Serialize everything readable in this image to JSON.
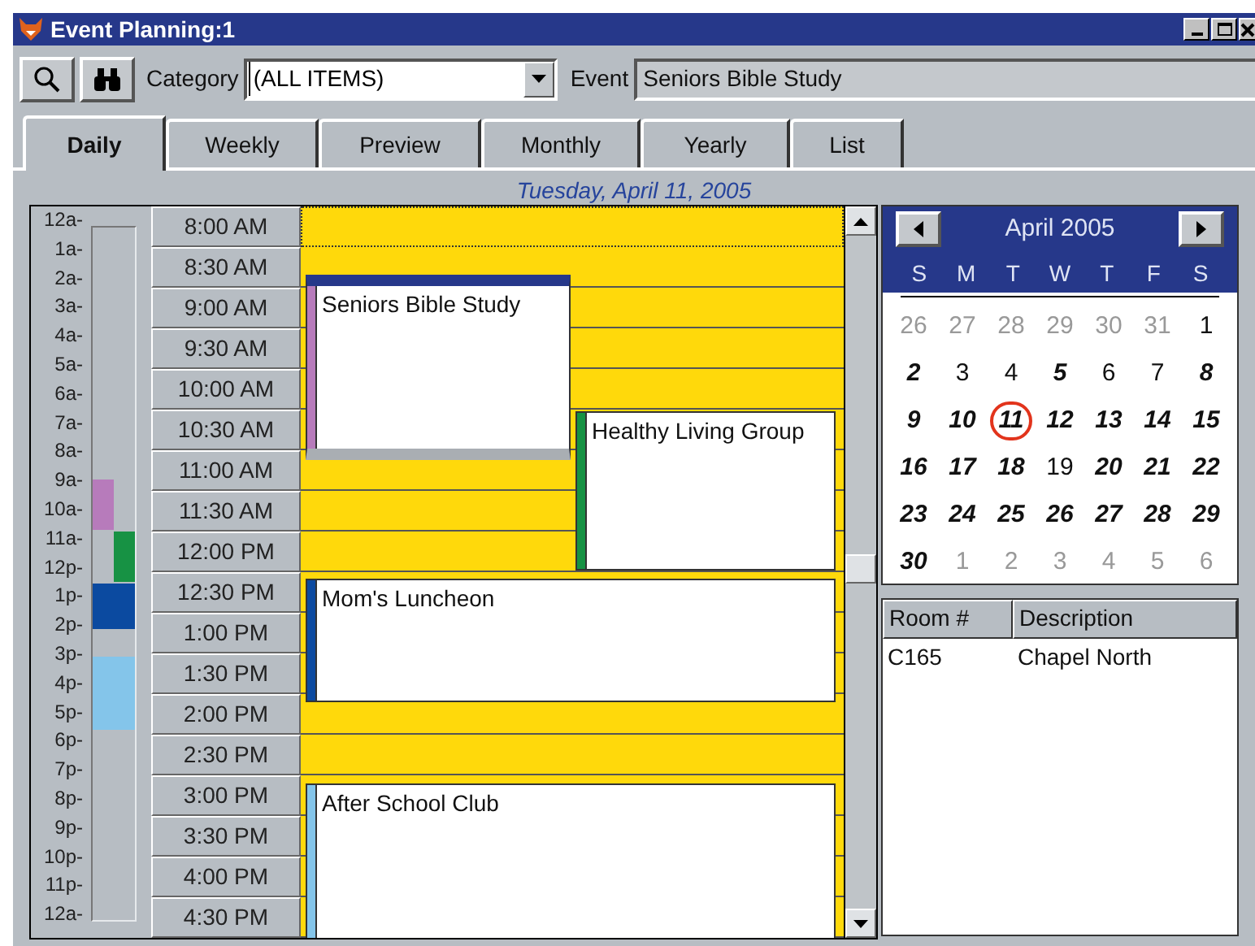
{
  "window": {
    "title": "Event Planning:1"
  },
  "toolbar": {
    "category_label": "Category",
    "category": "(ALL ITEMS)",
    "event_label": "Event",
    "event": "Seniors Bible Study"
  },
  "tabs": [
    {
      "label": "Daily",
      "selected": true
    },
    {
      "label": "Weekly",
      "selected": false
    },
    {
      "label": "Preview",
      "selected": false
    },
    {
      "label": "Monthly",
      "selected": false
    },
    {
      "label": "Yearly",
      "selected": false
    },
    {
      "label": "List",
      "selected": false
    }
  ],
  "date_heading": "Tuesday, April 11, 2005",
  "hour_labels": [
    "12a-",
    "1a-",
    "2a-",
    "3a-",
    "4a-",
    "5a-",
    "6a-",
    "7a-",
    "8a-",
    "9a-",
    "10a-",
    "11a-",
    "12p-",
    "1p-",
    "2p-",
    "3p-",
    "4p-",
    "5p-",
    "6p-",
    "7p-",
    "8p-",
    "9p-",
    "10p-",
    "11p-",
    "12a-"
  ],
  "time_slots": [
    {
      "label": "8:00 AM",
      "selected": true
    },
    {
      "label": "8:30 AM",
      "selected": false
    },
    {
      "label": "9:00 AM",
      "selected": false
    },
    {
      "label": "9:30 AM",
      "selected": false
    },
    {
      "label": "10:00 AM",
      "selected": false
    },
    {
      "label": "10:30 AM",
      "selected": false
    },
    {
      "label": "11:00 AM",
      "selected": false
    },
    {
      "label": "11:30 AM",
      "selected": false
    },
    {
      "label": "12:00 PM",
      "selected": false
    },
    {
      "label": "12:30 PM",
      "selected": false
    },
    {
      "label": "1:00 PM",
      "selected": false
    },
    {
      "label": "1:30 PM",
      "selected": false
    },
    {
      "label": "2:00 PM",
      "selected": false
    },
    {
      "label": "2:30 PM",
      "selected": false
    },
    {
      "label": "3:00 PM",
      "selected": false
    },
    {
      "label": "3:30 PM",
      "selected": false
    },
    {
      "label": "4:00 PM",
      "selected": false
    },
    {
      "label": "4:30 PM",
      "selected": false
    }
  ],
  "events": [
    {
      "title": "Seniors Bible Study",
      "color": "#b77bbb",
      "selected": true
    },
    {
      "title": "Healthy Living Group",
      "color": "#179244",
      "selected": false
    },
    {
      "title": "Mom's Luncheon",
      "color": "#0b4aa0",
      "selected": false
    },
    {
      "title": "After School Club",
      "color": "#84c5ea",
      "selected": false
    }
  ],
  "calendar": {
    "month": "April 2005",
    "weekdays": [
      "S",
      "M",
      "T",
      "W",
      "T",
      "F",
      "S"
    ],
    "days": [
      {
        "label": "26",
        "kind": "other"
      },
      {
        "label": "27",
        "kind": "other"
      },
      {
        "label": "28",
        "kind": "other"
      },
      {
        "label": "29",
        "kind": "other"
      },
      {
        "label": "30",
        "kind": "other"
      },
      {
        "label": "31",
        "kind": "other"
      },
      {
        "label": "1",
        "kind": "plain"
      },
      {
        "label": "2",
        "kind": "busy"
      },
      {
        "label": "3",
        "kind": "plain"
      },
      {
        "label": "4",
        "kind": "plain"
      },
      {
        "label": "5",
        "kind": "busy"
      },
      {
        "label": "6",
        "kind": "plain"
      },
      {
        "label": "7",
        "kind": "plain"
      },
      {
        "label": "8",
        "kind": "busy"
      },
      {
        "label": "9",
        "kind": "busy"
      },
      {
        "label": "10",
        "kind": "busy"
      },
      {
        "label": "11",
        "kind": "busy",
        "selected": true
      },
      {
        "label": "12",
        "kind": "busy"
      },
      {
        "label": "13",
        "kind": "busy"
      },
      {
        "label": "14",
        "kind": "busy"
      },
      {
        "label": "15",
        "kind": "busy"
      },
      {
        "label": "16",
        "kind": "busy"
      },
      {
        "label": "17",
        "kind": "busy"
      },
      {
        "label": "18",
        "kind": "busy"
      },
      {
        "label": "19",
        "kind": "plain"
      },
      {
        "label": "20",
        "kind": "busy"
      },
      {
        "label": "21",
        "kind": "busy"
      },
      {
        "label": "22",
        "kind": "busy"
      },
      {
        "label": "23",
        "kind": "busy"
      },
      {
        "label": "24",
        "kind": "busy"
      },
      {
        "label": "25",
        "kind": "busy"
      },
      {
        "label": "26",
        "kind": "busy"
      },
      {
        "label": "27",
        "kind": "busy"
      },
      {
        "label": "28",
        "kind": "busy"
      },
      {
        "label": "29",
        "kind": "busy"
      },
      {
        "label": "30",
        "kind": "busy"
      },
      {
        "label": "1",
        "kind": "other"
      },
      {
        "label": "2",
        "kind": "other"
      },
      {
        "label": "3",
        "kind": "other"
      },
      {
        "label": "4",
        "kind": "other"
      },
      {
        "label": "5",
        "kind": "other"
      },
      {
        "label": "6",
        "kind": "other"
      }
    ]
  },
  "rooms": {
    "columns": [
      "Room #",
      "Description"
    ],
    "rows": [
      [
        "C165",
        "Chapel North"
      ]
    ]
  }
}
